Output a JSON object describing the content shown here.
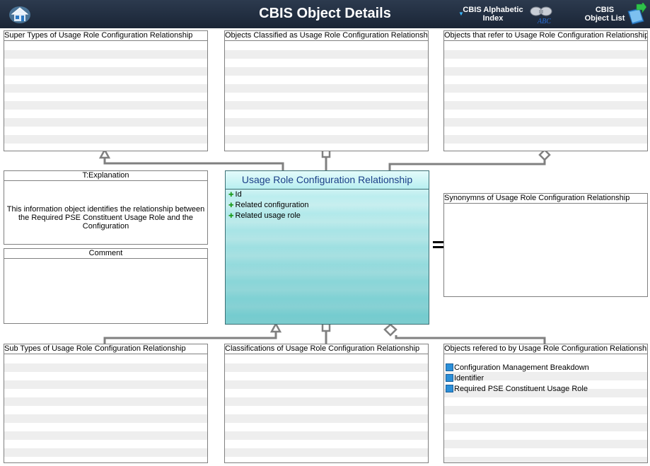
{
  "header": {
    "title": "CBIS Object Details",
    "alpha_index_line1": "CBIS Alphabetic",
    "alpha_index_line2": "Index",
    "object_list_line1": "CBIS",
    "object_list_line2": "Object List",
    "colors": {
      "bar": "#1f2b3d",
      "text": "#ffffff",
      "accent": "#39b8ff"
    }
  },
  "panels": {
    "super_types": "Super Types of Usage Role Configuration Relationship",
    "classified_as": "Objects Classified as  Usage Role Configuration Relationship",
    "refer_to": "Objects that refer to   Usage Role Configuration Relationship",
    "explanation_title": "T:Explanation",
    "explanation_text": "This information object identifies the relationship between the Required PSE Constituent Usage Role and the Configuration",
    "comment_title": "Comment",
    "synonyms": "Synonymns  of Usage Role Configuration Relationship",
    "sub_types": "Sub Types of Usage Role Configuration Relationship",
    "classifications": "Classifications of Usage Role Configuration Relationship",
    "refered_by": "Objects refered to by   Usage Role Configuration Relationship"
  },
  "class_box": {
    "name": "Usage Role Configuration Relationship",
    "attributes": [
      "Id",
      "Related configuration",
      "Related usage role"
    ],
    "colors": {
      "fill": "#8ad9dc",
      "title_text": "#1b3f88"
    }
  },
  "refered_by_items": [
    "Configuration Management  Breakdown",
    "Identifier",
    "Required PSE Constituent Usage Role"
  ]
}
